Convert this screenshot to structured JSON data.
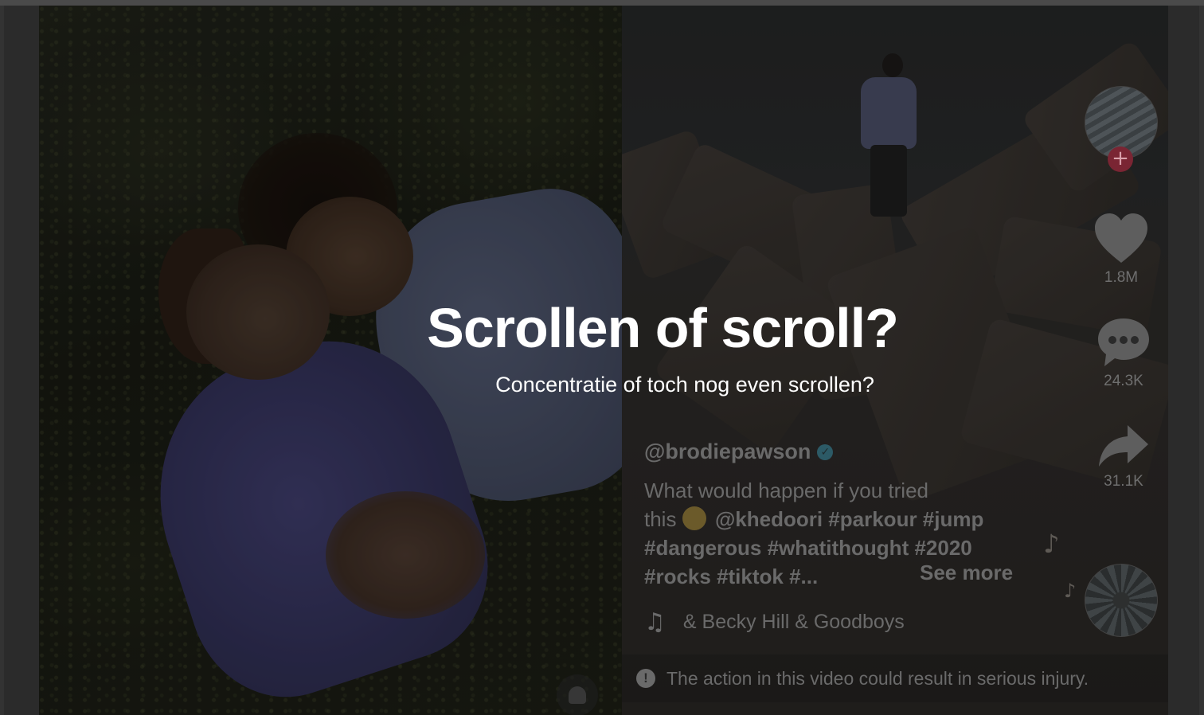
{
  "overlay": {
    "title": "Scrollen of scroll?",
    "subtitle": "Concentratie of toch nog even scrollen?"
  },
  "video": {
    "username": "@brodiepawson",
    "description_line1": "What would happen if you tried",
    "description_line2_text": "this",
    "description_tags_line2": "@khedoori #parkour #jump",
    "description_line3": "#dangerous #whatithought #2020",
    "description_line4": "#rocks #tiktok #...",
    "see_more": "See more",
    "music": "& Becky Hill & Goodboys",
    "warning": "The action in this video could result in serious injury."
  },
  "actions": {
    "likes": "1.8M",
    "comments": "24.3K",
    "shares": "31.1K",
    "follow_symbol": "+"
  },
  "icons": {
    "like": "heart-icon",
    "comment": "comment-bubble-icon",
    "share": "share-arrow-icon",
    "music": "music-note-icon",
    "verified": "verified-check-icon",
    "warning": "warning-exclamation-icon",
    "follow": "plus-icon"
  },
  "colors": {
    "overlay_text": "#ffffff",
    "muted_text": "#6a6a6a",
    "follow_accent": "#7a2533",
    "verified": "#2c5a66"
  }
}
